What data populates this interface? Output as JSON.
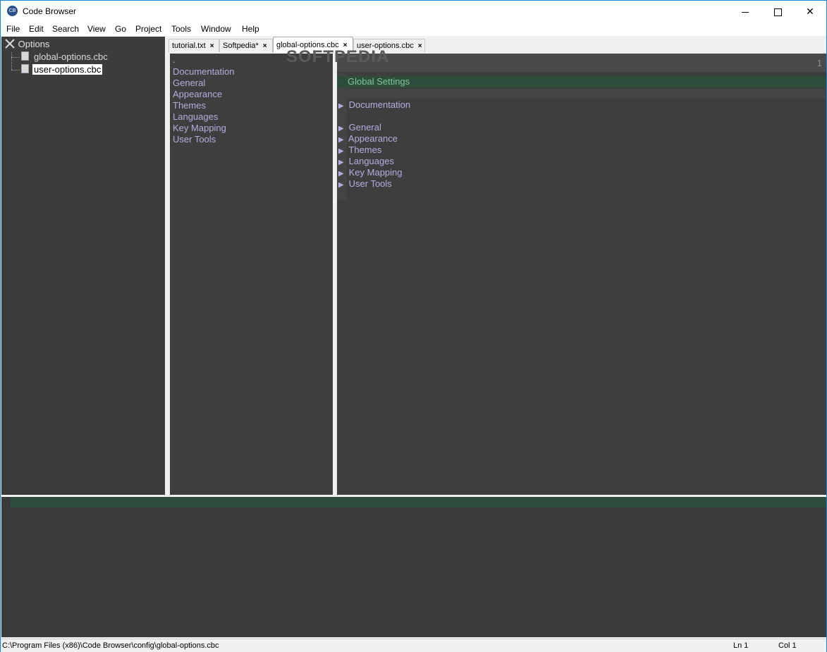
{
  "window": {
    "title": "Code Browser",
    "app_icon_text": "CB",
    "close_glyph": "✕"
  },
  "menu": {
    "items": [
      "File",
      "Edit",
      "Search",
      "View",
      "Go",
      "Project",
      "Tools",
      "Window",
      "Help"
    ]
  },
  "tree": {
    "root_label": "Options",
    "items": [
      {
        "label": "global-options.cbc",
        "selected": false
      },
      {
        "label": "user-options.cbc",
        "selected": true
      }
    ]
  },
  "tabs": [
    {
      "label": "tutorial.txt",
      "active": false
    },
    {
      "label": "Softpedia*",
      "active": false
    },
    {
      "label": "global-options.cbc",
      "active": true
    },
    {
      "label": "user-options.cbc",
      "active": false
    }
  ],
  "tab_close_glyph": "×",
  "outline": {
    "dot": ".",
    "items": [
      "Documentation",
      "General",
      "Appearance",
      "Themes",
      "Languages",
      "Key Mapping",
      "User Tools"
    ]
  },
  "editor": {
    "line_number": "1",
    "heading": "Global Settings",
    "arrow_glyph": "▶",
    "items": [
      "Documentation",
      "General",
      "Appearance",
      "Themes",
      "Languages",
      "Key Mapping",
      "User Tools"
    ]
  },
  "watermark": "SOFTPEDIA",
  "status": {
    "path": "C:\\Program Files (x86)\\Code Browser\\config\\global-options.cbc",
    "line": "Ln 1",
    "col": "Col 1"
  },
  "colors": {
    "pane_background": "#3e3e3e",
    "link_text": "#b2aee0",
    "heading_text": "#7fc99a",
    "heading_bar": "#2f4d3d"
  }
}
